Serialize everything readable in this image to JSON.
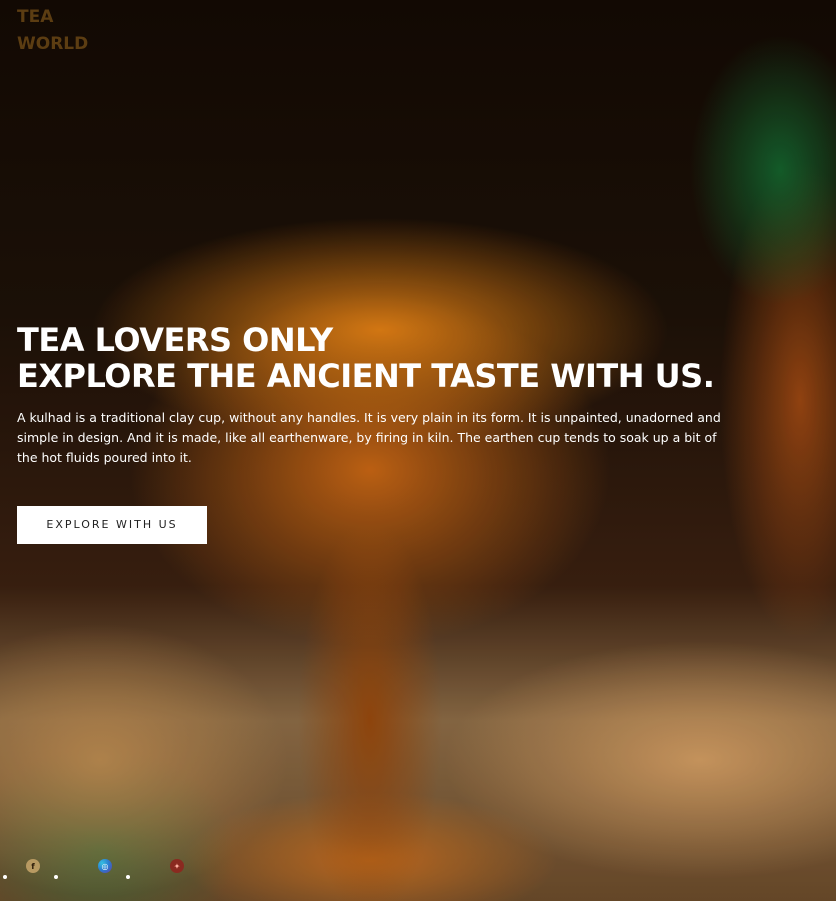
{
  "brand": {
    "line1": "TEA",
    "line2": "WORLD"
  },
  "hero": {
    "headline_line1": "TEA LOVERS ONLY",
    "headline_line2": "EXPLORE THE ANCIENT TASTE WITH US.",
    "description": "A kulhad is a traditional clay cup, without any handles. It is very plain in its form. It is unpainted, unadorned and simple in design. And it is made, like all earthenware, by firing in kiln. The earthen cup tends to soak up a bit of the hot fluids poured into it.",
    "cta_label": "EXPLORE WITH US"
  },
  "social": {
    "icons": [
      {
        "name": "facebook-icon",
        "glyph": "f"
      },
      {
        "name": "instagram-icon",
        "glyph": "◎"
      },
      {
        "name": "twitter-icon",
        "glyph": "✦"
      }
    ]
  },
  "colors": {
    "brand_text": "#5c3d12",
    "headline": "#ffffff",
    "cta_background": "#ffffff",
    "cta_text": "#222222"
  }
}
